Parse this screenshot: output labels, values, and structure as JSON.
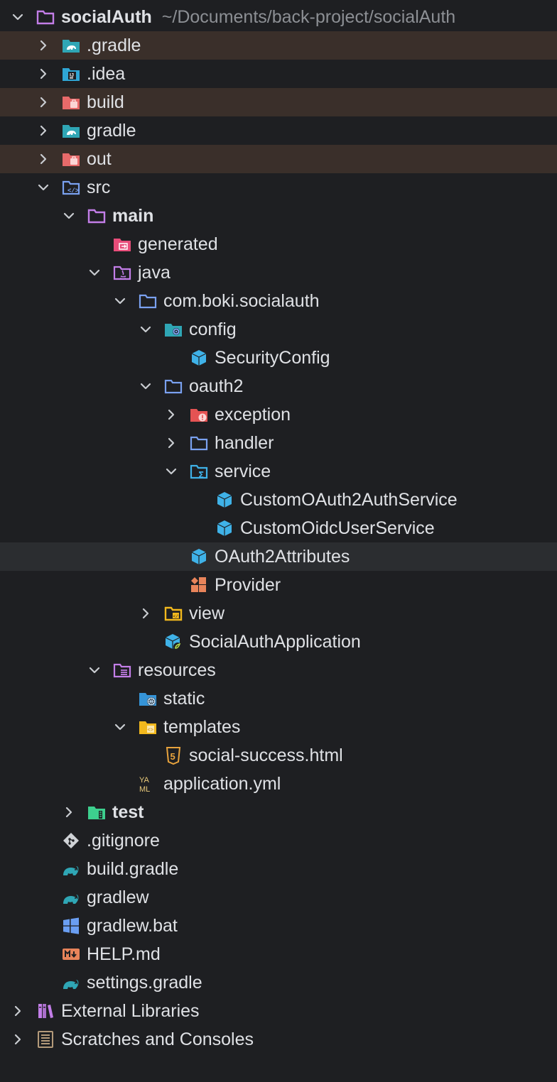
{
  "tree": [
    {
      "name": "project-root",
      "label": "socialAuth",
      "path": "~/Documents/back-project/socialAuth",
      "depth": 0,
      "chevron": "down",
      "icon": "folder-icon",
      "bold": true
    },
    {
      "name": "folder-gradle-hidden",
      "label": ".gradle",
      "depth": 1,
      "chevron": "right",
      "icon": "gradle-folder-icon",
      "excluded": true
    },
    {
      "name": "folder-idea",
      "label": ".idea",
      "depth": 1,
      "chevron": "right",
      "icon": "idea-folder-icon"
    },
    {
      "name": "folder-build",
      "label": "build",
      "depth": 1,
      "chevron": "right",
      "icon": "excluded-folder-icon",
      "excluded": true
    },
    {
      "name": "folder-gradle",
      "label": "gradle",
      "depth": 1,
      "chevron": "right",
      "icon": "gradle-folder-icon"
    },
    {
      "name": "folder-out",
      "label": "out",
      "depth": 1,
      "chevron": "right",
      "icon": "excluded-folder-icon",
      "excluded": true
    },
    {
      "name": "folder-src",
      "label": "src",
      "depth": 1,
      "chevron": "down",
      "icon": "source-folder-icon"
    },
    {
      "name": "folder-main",
      "label": "main",
      "depth": 2,
      "chevron": "down",
      "icon": "folder-icon",
      "bold": true
    },
    {
      "name": "folder-generated",
      "label": "generated",
      "depth": 3,
      "chevron": "none",
      "icon": "generated-folder-icon"
    },
    {
      "name": "folder-java",
      "label": "java",
      "depth": 3,
      "chevron": "down",
      "icon": "java-folder-icon"
    },
    {
      "name": "package-com-boki-socialauth",
      "label": "com.boki.socialauth",
      "depth": 4,
      "chevron": "down",
      "icon": "package-icon"
    },
    {
      "name": "package-config",
      "label": "config",
      "depth": 5,
      "chevron": "down",
      "icon": "config-folder-icon"
    },
    {
      "name": "file-securityconfig",
      "label": "SecurityConfig",
      "depth": 6,
      "chevron": "none",
      "icon": "class-icon"
    },
    {
      "name": "package-oauth2",
      "label": "oauth2",
      "depth": 5,
      "chevron": "down",
      "icon": "package-icon"
    },
    {
      "name": "package-exception",
      "label": "exception",
      "depth": 6,
      "chevron": "right",
      "icon": "exception-folder-icon"
    },
    {
      "name": "package-handler",
      "label": "handler",
      "depth": 6,
      "chevron": "right",
      "icon": "package-icon"
    },
    {
      "name": "package-service",
      "label": "service",
      "depth": 6,
      "chevron": "down",
      "icon": "service-folder-icon"
    },
    {
      "name": "file-customoauth2authservice",
      "label": "CustomOAuth2AuthService",
      "depth": 7,
      "chevron": "none",
      "icon": "class-icon"
    },
    {
      "name": "file-customoidcuserservice",
      "label": "CustomOidcUserService",
      "depth": 7,
      "chevron": "none",
      "icon": "class-icon"
    },
    {
      "name": "file-oauth2attributes",
      "label": "OAuth2Attributes",
      "depth": 6,
      "chevron": "none",
      "icon": "class-icon",
      "selected": true
    },
    {
      "name": "file-provider",
      "label": "Provider",
      "depth": 6,
      "chevron": "none",
      "icon": "enum-icon"
    },
    {
      "name": "package-view",
      "label": "view",
      "depth": 5,
      "chevron": "right",
      "icon": "view-folder-icon"
    },
    {
      "name": "file-socialauthapplication",
      "label": "SocialAuthApplication",
      "depth": 5,
      "chevron": "none",
      "icon": "spring-class-icon"
    },
    {
      "name": "folder-resources",
      "label": "resources",
      "depth": 3,
      "chevron": "down",
      "icon": "resources-folder-icon"
    },
    {
      "name": "folder-static",
      "label": "static",
      "depth": 4,
      "chevron": "none",
      "icon": "web-folder-icon"
    },
    {
      "name": "folder-templates",
      "label": "templates",
      "depth": 4,
      "chevron": "down",
      "icon": "templates-folder-icon"
    },
    {
      "name": "file-social-success-html",
      "label": "social-success.html",
      "depth": 5,
      "chevron": "none",
      "icon": "html5-icon"
    },
    {
      "name": "file-application-yml",
      "label": "application.yml",
      "depth": 4,
      "chevron": "none",
      "icon": "yaml-icon"
    },
    {
      "name": "folder-test",
      "label": "test",
      "depth": 2,
      "chevron": "right",
      "icon": "test-folder-icon",
      "bold": true
    },
    {
      "name": "file-gitignore",
      "label": ".gitignore",
      "depth": 1,
      "chevron": "none",
      "icon": "git-icon"
    },
    {
      "name": "file-build-gradle",
      "label": "build.gradle",
      "depth": 1,
      "chevron": "none",
      "icon": "gradle-elephant-icon"
    },
    {
      "name": "file-gradlew",
      "label": "gradlew",
      "depth": 1,
      "chevron": "none",
      "icon": "gradle-elephant-icon"
    },
    {
      "name": "file-gradlew-bat",
      "label": "gradlew.bat",
      "depth": 1,
      "chevron": "none",
      "icon": "windows-icon"
    },
    {
      "name": "file-help-md",
      "label": "HELP.md",
      "depth": 1,
      "chevron": "none",
      "icon": "markdown-icon"
    },
    {
      "name": "file-settings-gradle",
      "label": "settings.gradle",
      "depth": 1,
      "chevron": "none",
      "icon": "gradle-elephant-icon"
    },
    {
      "name": "node-external-libraries",
      "label": "External Libraries",
      "depth": 0,
      "chevron": "right",
      "icon": "libraries-icon"
    },
    {
      "name": "node-scratches-consoles",
      "label": "Scratches and Consoles",
      "depth": 0,
      "chevron": "right",
      "icon": "scratches-icon"
    }
  ]
}
